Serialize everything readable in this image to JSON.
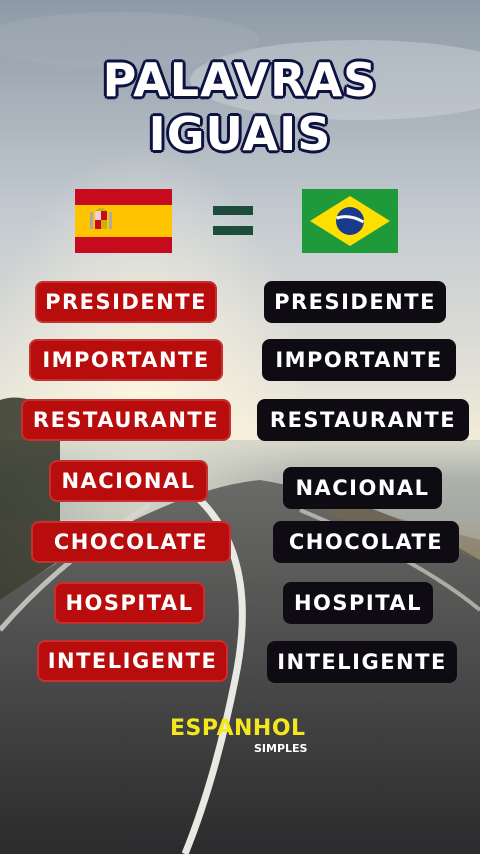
{
  "title": {
    "line1": "PALAVRAS",
    "line2": "IGUAIS"
  },
  "flags": {
    "left": "spain-flag",
    "right": "brazil-flag",
    "separator": "equals-sign"
  },
  "words": [
    {
      "spanish": "PRESIDENTE",
      "portuguese": "PRESIDENTE"
    },
    {
      "spanish": "IMPORTANTE",
      "portuguese": "IMPORTANTE"
    },
    {
      "spanish": "RESTAURANTE",
      "portuguese": "RESTAURANTE"
    },
    {
      "spanish": "NACIONAL",
      "portuguese": "NACIONAL"
    },
    {
      "spanish": "CHOCOLATE",
      "portuguese": "CHOCOLATE"
    },
    {
      "spanish": "HOSPITAL",
      "portuguese": "HOSPITAL"
    },
    {
      "spanish": "INTELIGENTE",
      "portuguese": "INTELIGENTE"
    }
  ],
  "brand": {
    "name": "ESPANHOL",
    "tagline": "SIMPLES"
  },
  "colors": {
    "spanish_pill": "#b90d0d",
    "portuguese_pill": "#0e0b12",
    "brand_yellow": "#f3e81e",
    "title_outline": "#0d1240"
  }
}
